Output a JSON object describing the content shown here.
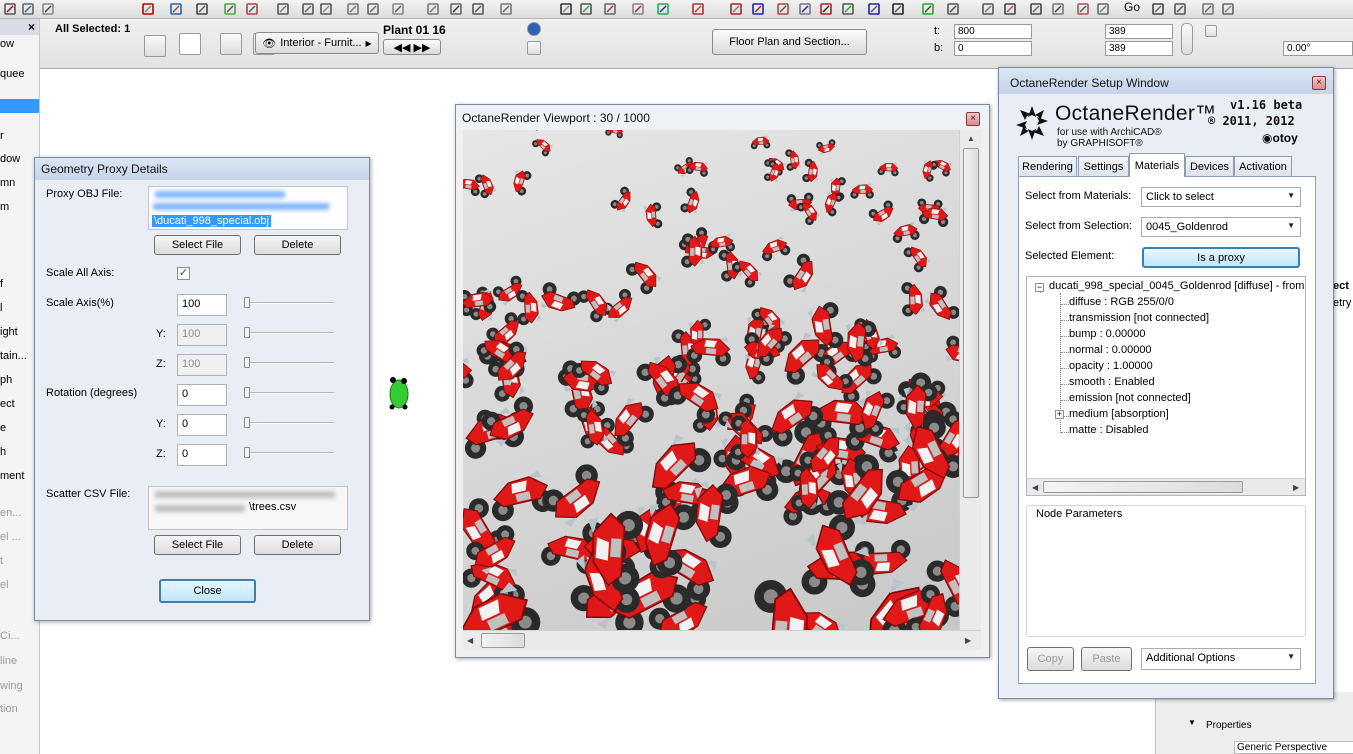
{
  "toolbar": {
    "go_label": "Go"
  },
  "infobox": {
    "selection_label": "All Selected: 1",
    "view_mode_label": "Interior - Furnit...",
    "story_label": "Plant 01 16",
    "floor_plan_button": "Floor Plan and Section...",
    "t_label": "t:",
    "b_label": "b:",
    "t_value": "800",
    "b_value": "0",
    "width_value": "389",
    "depth_value": "389",
    "angle_value": "0.00°"
  },
  "palette": {
    "items": [
      "ow",
      "quee",
      "r",
      "dow",
      "mn",
      "m",
      "f",
      "l",
      "ight",
      "tain...",
      "ph",
      "ect",
      "e",
      "h",
      "ment",
      "en...",
      "el ...",
      "t",
      "el",
      "Ci...",
      "line",
      "wing",
      "tion"
    ]
  },
  "proxy_dialog": {
    "title": "Geometry Proxy Details",
    "obj_file_label": "Proxy OBJ File:",
    "obj_file_name": "\\ducati_998_special.obj",
    "select_file_label": "Select File",
    "delete_label": "Delete",
    "scale_all_axis_label": "Scale All Axis:",
    "scale_axis_label": "Scale Axis(%)",
    "y_label": "Y:",
    "z_label": "Z:",
    "scale_x": "100",
    "scale_y": "100",
    "scale_z": "100",
    "rotation_label": "Rotation (degrees)",
    "rot_x": "0",
    "rot_y": "0",
    "rot_z": "0",
    "scatter_label": "Scatter CSV File:",
    "scatter_file_name": "\\trees.csv",
    "close_label": "Close"
  },
  "viewport": {
    "title": "OctaneRender Viewport : 30  / 1000"
  },
  "setup": {
    "title": "OctaneRender Setup Window",
    "logo_name": "OctaneRender™",
    "logo_sub1": "for use with ArchiCAD®",
    "logo_sub2": "by GRAPHISOFT®",
    "version": "v1.16 beta",
    "year": "® 2011, 2012",
    "brand": "otoy",
    "tabs": [
      "Rendering",
      "Settings",
      "Materials",
      "Devices",
      "Activation"
    ],
    "active_tab": "Materials",
    "select_materials_label": "Select from Materials:",
    "select_materials_value": "Click to select",
    "select_selection_label": "Select from Selection:",
    "select_selection_value": "0045_Goldenrod",
    "selected_element_label": "Selected Element:",
    "is_proxy_label": "Is a proxy",
    "tree_root": "ducati_998_special_0045_Goldenrod  [diffuse] - from",
    "tree_items": [
      "diffuse : RGB 255/0/0",
      "transmission  [not connected]",
      "bump : 0.00000",
      "normal : 0.00000",
      "opacity : 1.00000",
      "smooth : Enabled",
      "emission  [not connected]",
      "medium  [absorption]",
      "matte : Disabled"
    ],
    "node_params_label": "Node Parameters",
    "copy_label": "Copy",
    "paste_label": "Paste",
    "additional_label": "Additional Options"
  },
  "background_panel": {
    "partial_label_1": "ect",
    "partial_label_2": "etry",
    "properties_label": "Properties",
    "generic_label": "Generic Perspective"
  },
  "colors": {
    "window_bg": "#e9eef5",
    "title_bar": "#c4d4ea",
    "bike_red": "#e01818",
    "selection_blue": "#3399ff"
  }
}
